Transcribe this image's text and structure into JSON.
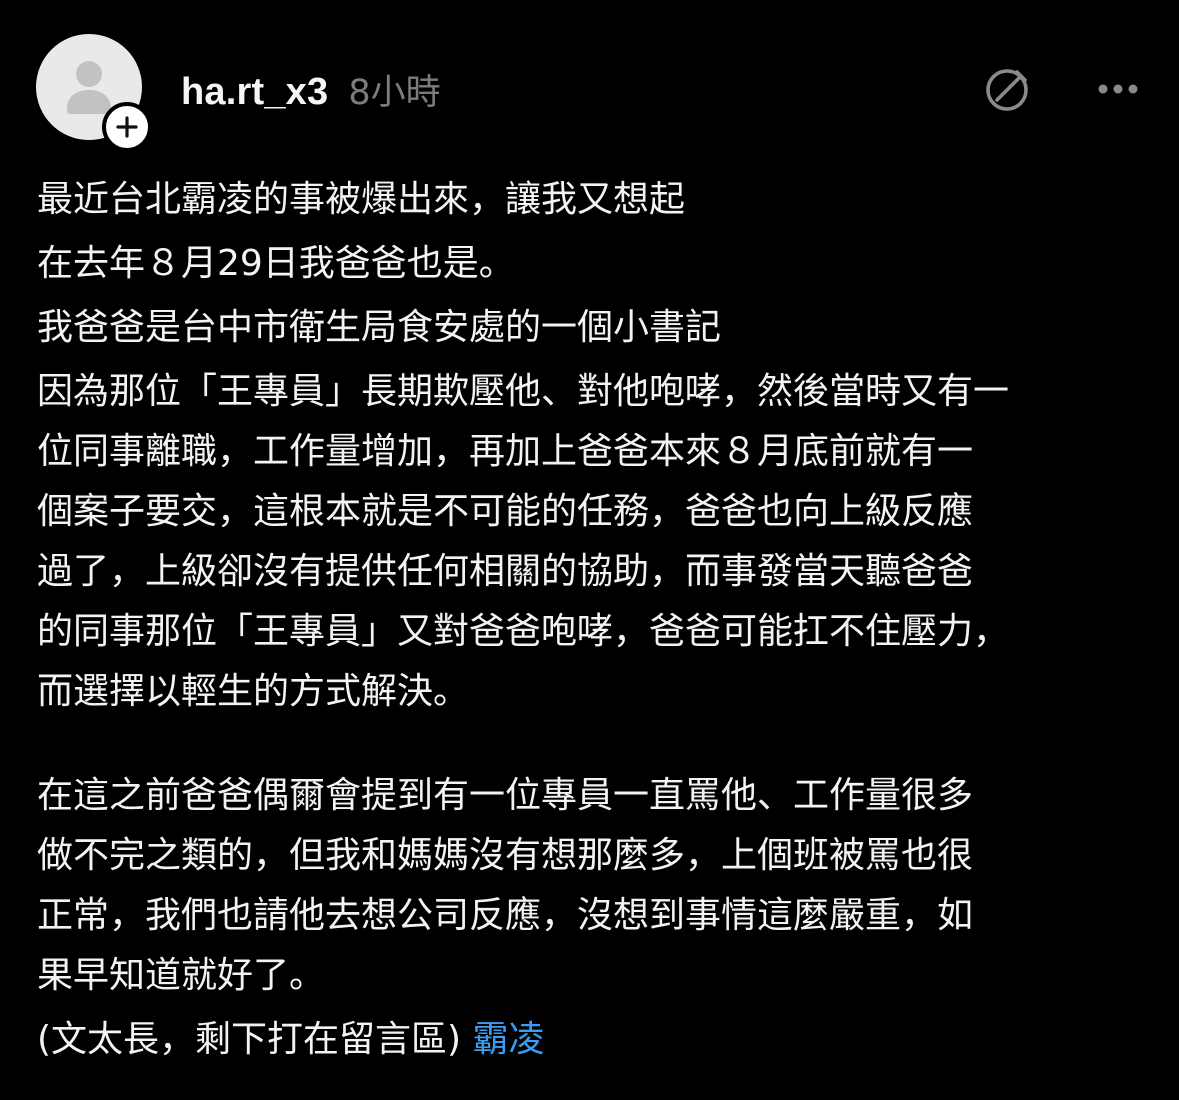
{
  "post": {
    "username": "ha.rt_x3",
    "timestamp": "8小時",
    "icons": {
      "avatar": "default-user-avatar",
      "follow": "plus-icon",
      "translate": "slashed-pencil-icon",
      "more": "more-horizontal-icon"
    },
    "colors": {
      "background": "#000000",
      "text": "#f3f3f3",
      "secondary": "#7c7c7c",
      "link": "#3b9cf4"
    },
    "lines": [
      "最近台北霸凌的事被爆出來，讓我又想起",
      "在去年８月29日我爸爸也是。",
      "我爸爸是台中市衛生局食安處的一個小書記",
      "因為那位「王專員」長期欺壓他、對他咆哮，然後當時又有一",
      "位同事離職，工作量增加，再加上爸爸本來８月底前就有一",
      "個案子要交，這根本就是不可能的任務，爸爸也向上級反應",
      "過了，上級卻沒有提供任何相關的協助，而事發當天聽爸爸",
      "的同事那位「王專員」又對爸爸咆哮，爸爸可能扛不住壓力，",
      "而選擇以輕生的方式解決。",
      "在這之前爸爸偶爾會提到有一位專員一直罵他、工作量很多",
      "做不完之類的，但我和媽媽沒有想那麼多，上個班被罵也很",
      "正常，我們也請他去想公司反應，沒想到事情這麼嚴重，如",
      "果早知道就好了。",
      "(文太長，剩下打在留言區)"
    ],
    "tag": "霸凌"
  }
}
